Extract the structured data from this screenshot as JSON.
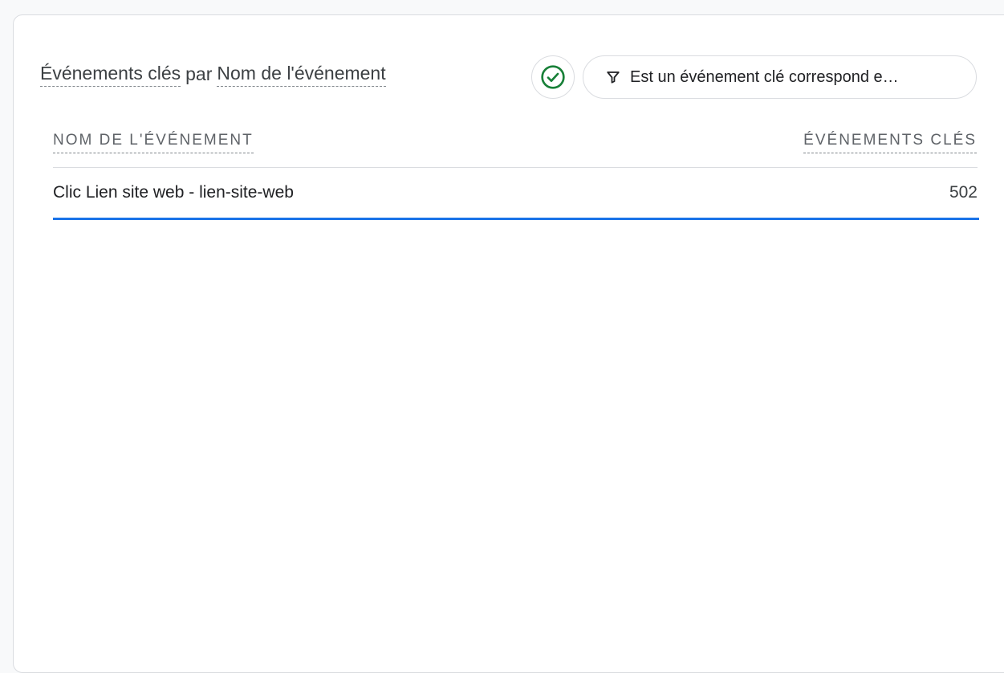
{
  "card": {
    "title": {
      "metric": "Événements clés",
      "connector": "par",
      "dimension": "Nom de l'événement"
    },
    "status_icon": "check-circle-icon",
    "filter": {
      "icon": "filter-icon",
      "label": "Est un événement clé correspond e…"
    }
  },
  "table": {
    "columns": [
      "NOM DE L'ÉVÉNEMENT",
      "ÉVÉNEMENTS CLÉS"
    ],
    "rows": [
      {
        "name": "Clic Lien site web - lien-site-web",
        "value": "502"
      }
    ]
  },
  "colors": {
    "accent": "#1a73e8",
    "success": "#188038",
    "text_primary": "#202124",
    "text_secondary": "#5f6368",
    "border": "#dadce0",
    "background": "#f8f9fa"
  }
}
